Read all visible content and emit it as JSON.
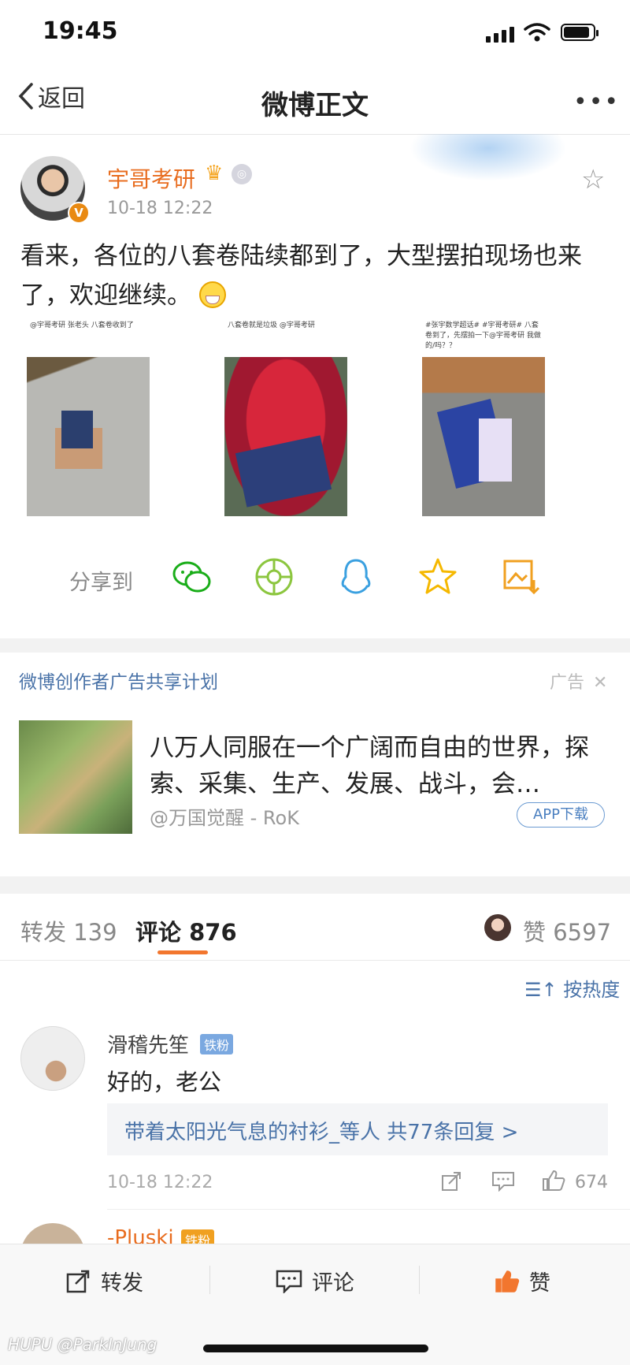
{
  "status_bar": {
    "time": "19:45",
    "battery_level": 0.9
  },
  "nav": {
    "back_label": "返回",
    "title": "微博正文",
    "more": "•••"
  },
  "post": {
    "author": "宇哥考研",
    "time": "10-18 12:22",
    "text": "看来，各位的八套卷陆续都到了，大型摆拍现场也来了，欢迎继续。",
    "images": [
      {
        "caption": "@宇哥考研 张老头 八套卷收到了"
      },
      {
        "caption": "八套卷就是垃圾 @宇哥考研"
      },
      {
        "caption": "#张宇数学超话# #宇哥考研# 八套卷到了，先摆拍一下@宇哥考研 我做的/吗？？"
      }
    ]
  },
  "share": {
    "label": "分享到",
    "icons": [
      "wechat-icon",
      "moments-icon",
      "qq-icon",
      "qzone-icon",
      "save-image-icon"
    ]
  },
  "ad": {
    "header": "微博创作者广告共享计划",
    "tag": "广告",
    "text": "八万人同服在一个广阔而自由的世界，探索、采集、生产、发展、战斗，会…",
    "source": "@万国觉醒 - RoK",
    "button": "APP下载"
  },
  "tabs": {
    "repost_label": "转发",
    "repost_count": "139",
    "comment_label": "评论",
    "comment_count": "876",
    "like_label": "赞",
    "like_count": "6597"
  },
  "sort": {
    "label": "按热度"
  },
  "comments": [
    {
      "name": "滑稽先笙",
      "badge": "铁粉",
      "text": "好的，老公",
      "replies": "带着太阳光气息的衬衫_等人  共77条回复 >",
      "time": "10-18 12:22",
      "likes": "674"
    },
    {
      "name": "-Pluski",
      "badge": "铁粉"
    }
  ],
  "bottom_bar": {
    "repost": "转发",
    "comment": "评论",
    "like": "赞"
  },
  "watermark": "HUPU @ParkInJung",
  "colors": {
    "accent": "#f2762e",
    "link": "#4a73a8",
    "username": "#e86c1e"
  }
}
